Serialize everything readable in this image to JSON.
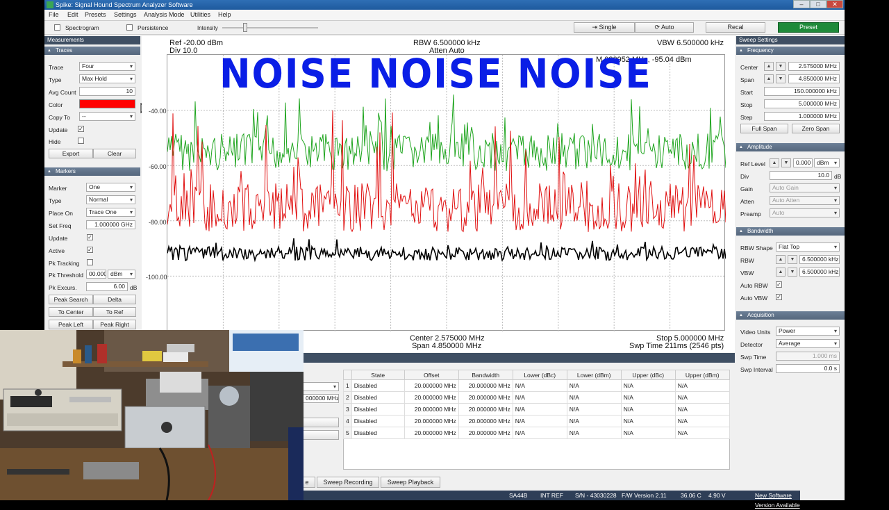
{
  "window": {
    "title": "Spike: Signal Hound Spectrum Analyzer Software",
    "controls": [
      "–",
      "□",
      "✕"
    ]
  },
  "menu": [
    "File",
    "Edit",
    "Presets",
    "Settings",
    "Analysis Mode",
    "Utilities",
    "Help"
  ],
  "toolbar": {
    "spectrogram": "Spectrogram",
    "persistence": "Persistence",
    "intensity": "Intensity",
    "single": "Single",
    "auto": "Auto",
    "recal": "Recal",
    "preset": "Preset"
  },
  "left": {
    "header": "Measurements",
    "traces": {
      "title": "Traces",
      "trace_label": "Trace",
      "trace": "Four",
      "type_label": "Type",
      "type": "Max Hold",
      "avg_label": "Avg Count",
      "avg": "10",
      "color_label": "Color",
      "color": "#ff0000",
      "copy_label": "Copy To",
      "copy": "--",
      "update_label": "Update",
      "hide_label": "Hide",
      "export": "Export",
      "clear": "Clear"
    },
    "markers": {
      "title": "Markers",
      "marker_label": "Marker",
      "marker": "One",
      "type_label": "Type",
      "type": "Normal",
      "place_label": "Place On",
      "place": "Trace One",
      "setfreq_label": "Set Freq",
      "setfreq": "1.000000 GHz",
      "update_label": "Update",
      "active_label": "Active",
      "pktrack_label": "Pk Tracking",
      "pkthresh_label": "Pk Threshold",
      "pkthresh": "00.000",
      "pkthresh_unit": "dBm",
      "pkexc_label": "Pk Excurs.",
      "pkexc": "6.00",
      "pkexc_unit": "dB",
      "peak_search": "Peak Search",
      "delta": "Delta",
      "to_center": "To Center",
      "to_ref": "To Ref",
      "peak_left": "Peak Left",
      "peak_right": "Peak Right"
    }
  },
  "plot": {
    "ref": "Ref -20.00 dBm",
    "div": "Div 10.0",
    "rbw": "RBW 6.500000 kHz",
    "atten": "Atten Auto",
    "vbw": "VBW 6.500000 kHz",
    "marker_readout": "M 080952 MHz, -95.04 dBm",
    "center": "Center 2.575000 MHz",
    "span": "Span 4.850000 MHz",
    "stop": "Stop 5.000000 MHz",
    "swptime": "Swp Time 211ms (2546 pts)",
    "yticks": [
      "-40.00",
      "-60.00",
      "-80.00",
      "-100.00"
    ],
    "overlay": "NOISE  NOISE  NOISE",
    "colors": {
      "green": "#1fa51f",
      "red": "#e01010",
      "black": "#000000"
    }
  },
  "table": {
    "headers": [
      "",
      "State",
      "Offset",
      "Bandwidth",
      "Lower (dBc)",
      "Lower (dBm)",
      "Upper (dBc)",
      "Upper (dBm)"
    ],
    "rows": [
      [
        "1",
        "Disabled",
        "20.000000 MHz",
        "20.000000 MHz",
        "N/A",
        "N/A",
        "N/A",
        "N/A"
      ],
      [
        "2",
        "Disabled",
        "20.000000 MHz",
        "20.000000 MHz",
        "N/A",
        "N/A",
        "N/A",
        "N/A"
      ],
      [
        "3",
        "Disabled",
        "20.000000 MHz",
        "20.000000 MHz",
        "N/A",
        "N/A",
        "N/A",
        "N/A"
      ],
      [
        "4",
        "Disabled",
        "20.000000 MHz",
        "20.000000 MHz",
        "N/A",
        "N/A",
        "N/A",
        "N/A"
      ],
      [
        "5",
        "Disabled",
        "20.000000 MHz",
        "20.000000 MHz",
        "N/A",
        "N/A",
        "N/A",
        "N/A"
      ]
    ],
    "partial_field": "000000 MHz"
  },
  "tabs": {
    "partial": "e",
    "recording": "Sweep Recording",
    "playback": "Sweep Playback"
  },
  "status": {
    "device": "SA44B",
    "ref": "INT REF",
    "serial": "S/N - 43030228",
    "fw": "F/W Version 2.11",
    "temp": "36.06 C",
    "volt": "4.90 V",
    "update": "New Software Version Available"
  },
  "right": {
    "header": "Sweep Settings",
    "frequency": {
      "title": "Frequency",
      "center_label": "Center",
      "center": "2.575000 MHz",
      "span_label": "Span",
      "span": "4.850000 MHz",
      "start_label": "Start",
      "start": "150.000000 kHz",
      "stop_label": "Stop",
      "stop": "5.000000 MHz",
      "step_label": "Step",
      "step": "1.000000 MHz",
      "full_span": "Full Span",
      "zero_span": "Zero Span"
    },
    "amplitude": {
      "title": "Amplitude",
      "ref_label": "Ref Level",
      "ref": "0.000",
      "ref_unit": "dBm",
      "div_label": "Div",
      "div": "10.0",
      "div_unit": "dB",
      "gain_label": "Gain",
      "gain": "Auto Gain",
      "atten_label": "Atten",
      "atten": "Auto Atten",
      "preamp_label": "Preamp",
      "preamp": "Auto"
    },
    "bandwidth": {
      "title": "Bandwidth",
      "shape_label": "RBW Shape",
      "shape": "Flat Top",
      "rbw_label": "RBW",
      "rbw": "6.500000 kHz",
      "vbw_label": "VBW",
      "vbw": "6.500000 kHz",
      "autorbw_label": "Auto RBW",
      "autovbw_label": "Auto VBW"
    },
    "acquisition": {
      "title": "Acquisition",
      "units_label": "Video Units",
      "units": "Power",
      "detector_label": "Detector",
      "detector": "Average",
      "swptime_label": "Swp Time",
      "swptime": "1.000 ms",
      "interval_label": "Swp Interval",
      "interval": "0.0 s"
    }
  }
}
